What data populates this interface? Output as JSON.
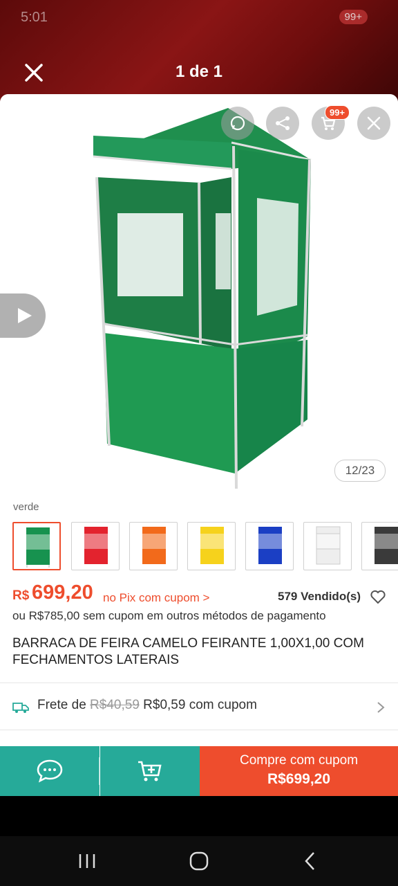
{
  "status_bar": {
    "time": "5:01",
    "notification_count": "99+"
  },
  "viewer": {
    "counter": "1 de 1"
  },
  "image": {
    "counter": "12/23",
    "cart_badge": "99+",
    "icons": [
      "whatsapp-share-icon",
      "share-icon",
      "cart-icon",
      "close-icon",
      "play-icon"
    ],
    "colors": {
      "tent_green": "#1f8f4e",
      "frame": "#d9d9d9"
    }
  },
  "product": {
    "variant_label": "verde",
    "variants": [
      {
        "color": "#17924f"
      },
      {
        "color": "#e3232e"
      },
      {
        "color": "#f26a1b"
      },
      {
        "color": "#f6d21c"
      },
      {
        "color": "#1b3fc4"
      },
      {
        "color": "#f2f2f2"
      },
      {
        "color": "#3a3a3a"
      }
    ],
    "price_currency": "R$",
    "price_value": "699,20",
    "price_pix": "no Pix com cupom >",
    "sold": "579 Vendido(s)",
    "alt_price": "ou R$785,00 sem cupom em outros métodos de pagamento",
    "title": "BARRACA DE FEIRA CAMELO FEIRANTE 1,00X1,00 COM FECHAMENTOS LATERAIS"
  },
  "shipping": {
    "prefix": "Frete de",
    "old_price": "R$40,59",
    "new_price": "R$0,59 com cupom"
  },
  "actions": {
    "buy_line1": "Compre com cupom",
    "buy_line2": "R$699,20"
  },
  "theme": {
    "accent": "#ee4d2d",
    "teal": "#26aa99"
  }
}
